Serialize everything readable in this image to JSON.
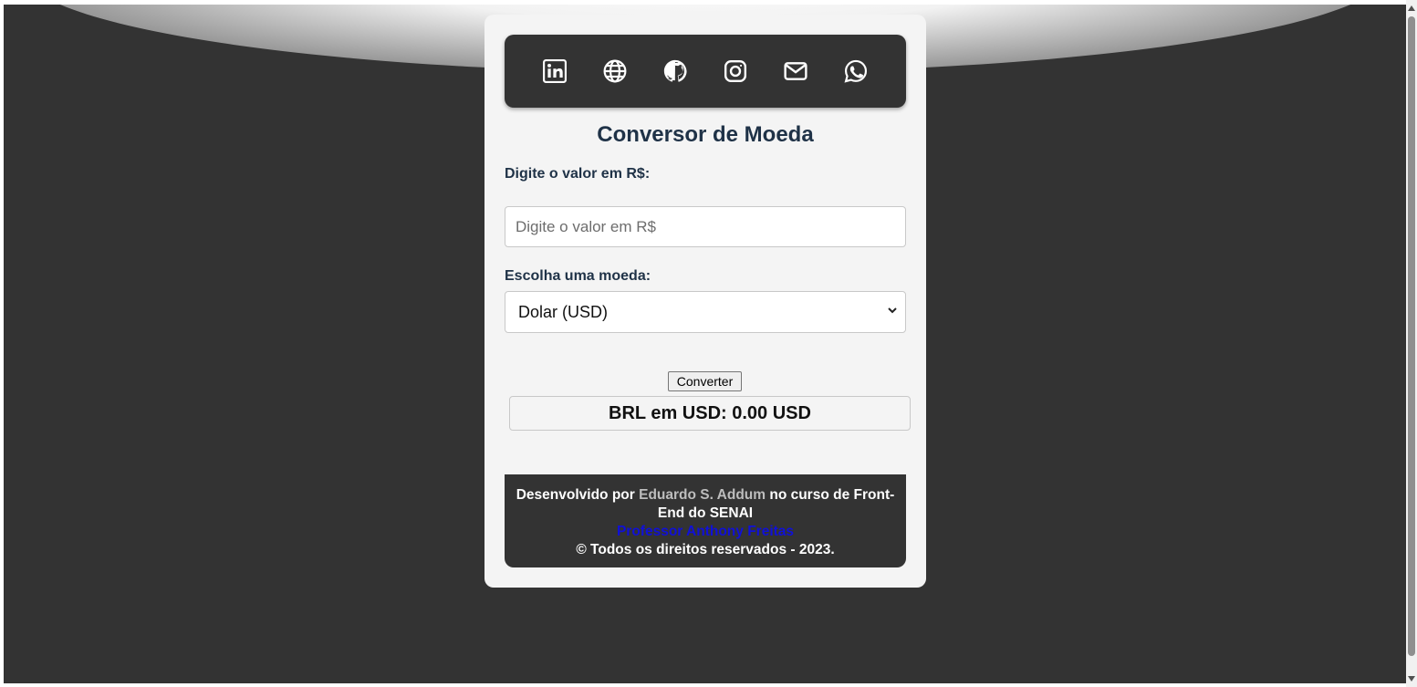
{
  "social": {
    "icons": [
      "linkedin-icon",
      "globe-icon",
      "github-icon",
      "instagram-icon",
      "mail-icon",
      "whatsapp-icon"
    ],
    "icon_color": "#ffffff"
  },
  "form": {
    "title": "Conversor de Moeda",
    "valor_label": "Digite o valor em R$:",
    "valor_placeholder": "Digite o valor em R$",
    "valor_value": "",
    "moeda_label": "Escolha uma moeda:",
    "moeda_selected": "Dolar (USD)",
    "convert_label": "Converter",
    "result_text": "BRL em USD: 0.00 USD"
  },
  "footer": {
    "prefix": "Desenvolvido por ",
    "author": "Eduardo S. Addum",
    "suffix": " no curso de Front-End do SENAI",
    "professor": "Professor Anthony Freitas",
    "copyright": "© Todos os direitos reservados - 2023."
  },
  "colors": {
    "background": "#333333",
    "card": "#f4f4f4",
    "title": "#1f3247",
    "professor_link": "#1010d8"
  }
}
